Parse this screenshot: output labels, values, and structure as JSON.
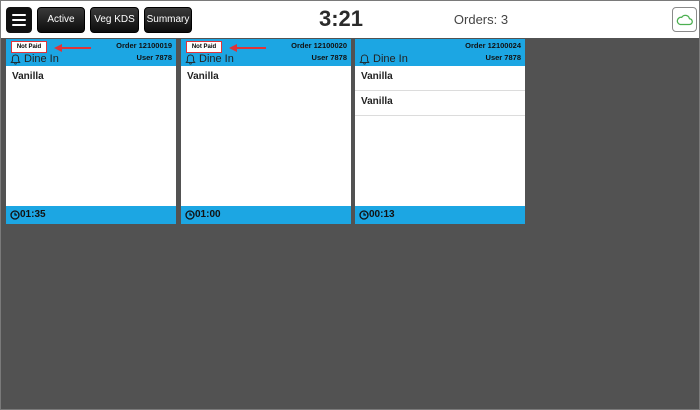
{
  "header": {
    "menu_icon": "hamburger-icon",
    "buttons": [
      {
        "label": "Active"
      },
      {
        "label": "Veg KDS"
      },
      {
        "label": "Summary"
      }
    ],
    "clock": "3:21",
    "orders_count": "Orders: 3",
    "sync_icon": "cloud-icon",
    "sync_color": "#4caf50"
  },
  "accent_color": "#1ca6e3",
  "annotation_color": "#e03339",
  "orders": [
    {
      "status_badge": "Not Paid",
      "order_label": "Order 12100019",
      "user_label": "User 7878",
      "type_label": "Dine In",
      "items": [
        "Vanilla"
      ],
      "timer": "01:35"
    },
    {
      "status_badge": "Not Paid",
      "order_label": "Order 12100020",
      "user_label": "User 7878",
      "type_label": "Dine In",
      "items": [
        "Vanilla"
      ],
      "timer": "01:00"
    },
    {
      "status_badge": "",
      "order_label": "Order 12100024",
      "user_label": "User 7878",
      "type_label": "Dine In",
      "items": [
        "Vanilla",
        "Vanilla"
      ],
      "timer": "00:13"
    }
  ]
}
